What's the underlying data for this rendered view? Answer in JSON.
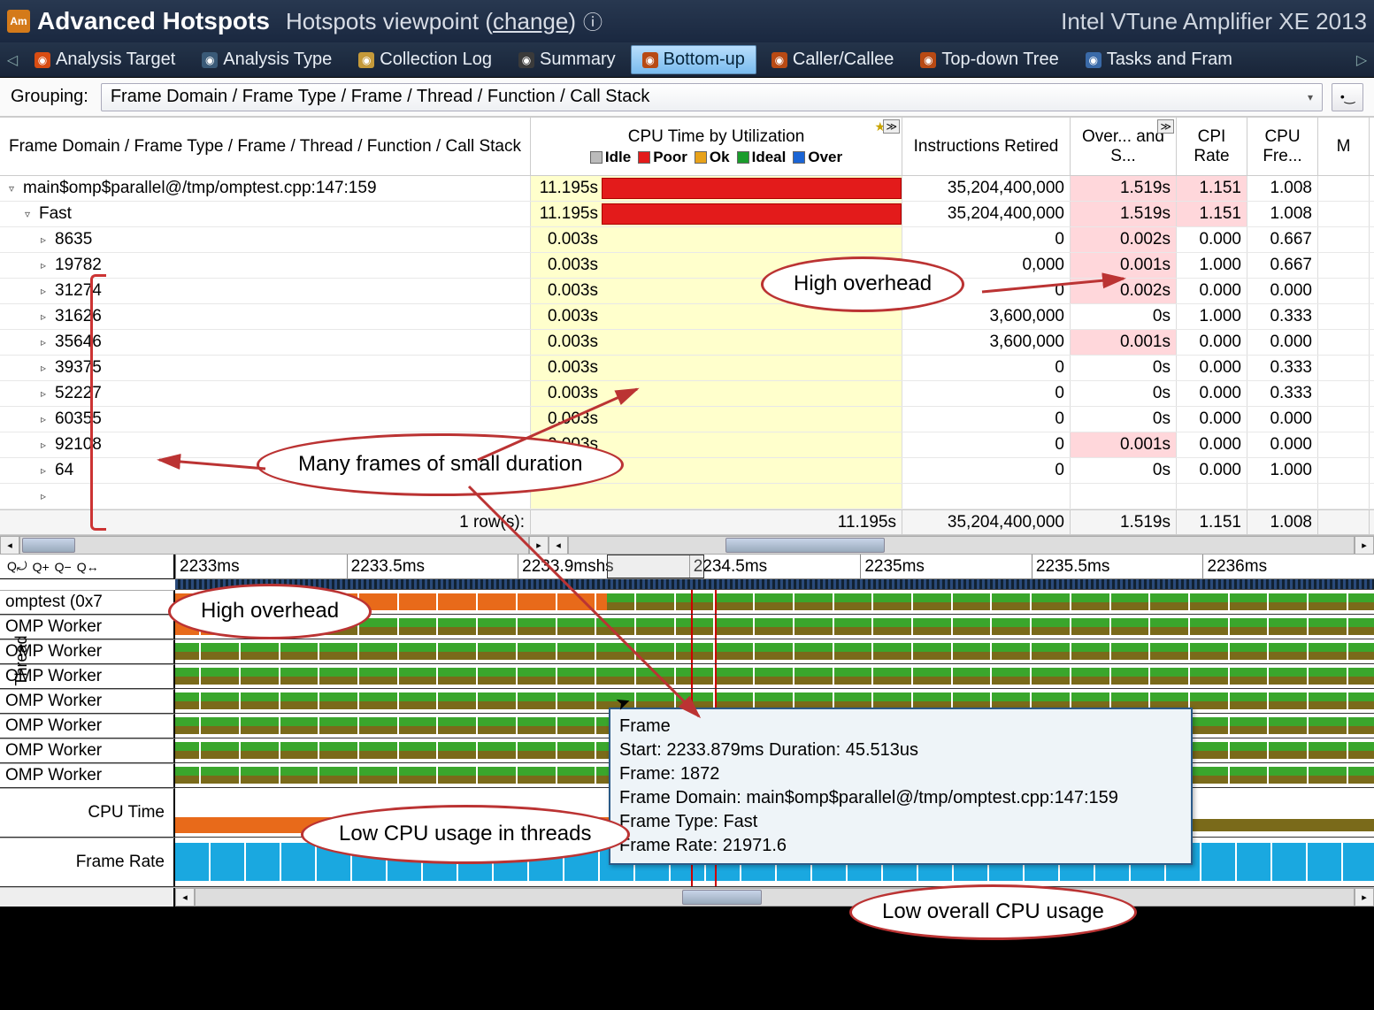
{
  "header": {
    "title": "Advanced Hotspots",
    "viewpoint_prefix": "Hotspots viewpoint (",
    "viewpoint_link": "change",
    "viewpoint_suffix": ")",
    "help": "ⓘ",
    "product": "Intel VTune Amplifier XE 2013"
  },
  "tabs": [
    {
      "label": "Analysis Target",
      "icon": "ic-target"
    },
    {
      "label": "Analysis Type",
      "icon": "ic-type"
    },
    {
      "label": "Collection Log",
      "icon": "ic-log"
    },
    {
      "label": "Summary",
      "icon": "ic-summary"
    },
    {
      "label": "Bottom-up",
      "icon": "ic-bottom",
      "active": true
    },
    {
      "label": "Caller/Callee",
      "icon": "ic-caller"
    },
    {
      "label": "Top-down Tree",
      "icon": "ic-topdown"
    },
    {
      "label": "Tasks and Fram",
      "icon": "ic-tasks"
    }
  ],
  "grouping": {
    "label": "Grouping:",
    "value": "Frame Domain / Frame Type / Frame / Thread / Function / Call Stack"
  },
  "columns": {
    "c0": "Frame Domain / Frame Type / Frame / Thread / Function / Call Stack",
    "c1": "CPU Time by Utilization",
    "c2": "Instructions Retired",
    "c3": "Over... and S...",
    "c4": "CPI Rate",
    "c5": "CPU Fre...",
    "c6": "M",
    "legend_idle": "Idle",
    "legend_poor": "Poor",
    "legend_ok": "Ok",
    "legend_ideal": "Ideal",
    "legend_over": "Over"
  },
  "rows": [
    {
      "indent": 1,
      "toggle": "▿",
      "name": "main$omp$parallel@/tmp/omptest.cpp:147:159",
      "time": "11.195s",
      "bar": 100,
      "instr": "35,204,400,000",
      "over": "1.519s",
      "over_pink": true,
      "cpi": "1.151",
      "cpi_pink": true,
      "fre": "1.008"
    },
    {
      "indent": 2,
      "toggle": "▿",
      "name": "Fast",
      "time": "11.195s",
      "bar": 100,
      "instr": "35,204,400,000",
      "over": "1.519s",
      "over_pink": true,
      "cpi": "1.151",
      "cpi_pink": true,
      "fre": "1.008"
    },
    {
      "indent": 3,
      "toggle": "▹",
      "name": "8635",
      "time": "0.003s",
      "bar": 0,
      "instr": "0",
      "over": "0.002s",
      "over_pink": true,
      "cpi": "0.000",
      "fre": "0.667"
    },
    {
      "indent": 3,
      "toggle": "▹",
      "name": "19782",
      "time": "0.003s",
      "bar": 0,
      "instr": "0,000",
      "over": "0.001s",
      "over_pink": true,
      "cpi": "1.000",
      "fre": "0.667"
    },
    {
      "indent": 3,
      "toggle": "▹",
      "name": "31274",
      "time": "0.003s",
      "bar": 0,
      "instr": "0",
      "over": "0.002s",
      "over_pink": true,
      "cpi": "0.000",
      "fre": "0.000"
    },
    {
      "indent": 3,
      "toggle": "▹",
      "name": "31626",
      "time": "0.003s",
      "bar": 0,
      "instr": "3,600,000",
      "over": "0s",
      "cpi": "1.000",
      "fre": "0.333"
    },
    {
      "indent": 3,
      "toggle": "▹",
      "name": "35646",
      "time": "0.003s",
      "bar": 0,
      "instr": "3,600,000",
      "over": "0.001s",
      "over_pink": true,
      "cpi": "0.000",
      "fre": "0.000"
    },
    {
      "indent": 3,
      "toggle": "▹",
      "name": "39375",
      "time": "0.003s",
      "bar": 0,
      "instr": "0",
      "over": "0s",
      "cpi": "0.000",
      "fre": "0.333"
    },
    {
      "indent": 3,
      "toggle": "▹",
      "name": "52227",
      "time": "0.003s",
      "bar": 0,
      "instr": "0",
      "over": "0s",
      "cpi": "0.000",
      "fre": "0.333"
    },
    {
      "indent": 3,
      "toggle": "▹",
      "name": "60355",
      "time": "0.003s",
      "bar": 0,
      "instr": "0",
      "over": "0s",
      "cpi": "0.000",
      "fre": "0.000"
    },
    {
      "indent": 3,
      "toggle": "▹",
      "name": "92108",
      "time": "0.003s",
      "bar": 0,
      "instr": "0",
      "over": "0.001s",
      "over_pink": true,
      "cpi": "0.000",
      "fre": "0.000"
    },
    {
      "indent": 3,
      "toggle": "▹",
      "name": "64",
      "time": "0.002s",
      "bar": 0,
      "instr": "0",
      "over": "0s",
      "cpi": "0.000",
      "fre": "1.000"
    },
    {
      "indent": 3,
      "toggle": "▹",
      "name": "",
      "time": "",
      "bar": -1,
      "instr": "",
      "over": "",
      "cpi": "",
      "fre": ""
    }
  ],
  "summary": {
    "label_suffix": "1 row(s):",
    "time": "11.195s",
    "instr": "35,204,400,000",
    "over": "1.519s",
    "cpi": "1.151",
    "fre": "1.008"
  },
  "ruler_ticks": [
    "2233ms",
    "2233.5ms",
    "2233.9ms",
    "2234.5ms",
    "2235ms",
    "2235.5ms",
    "2236ms"
  ],
  "ruler_extra": "hs",
  "threads": [
    "omptest (0x7",
    "OMP Worker",
    "OMP Worker",
    "OMP Worker",
    "OMP Worker",
    "OMP Worker",
    "OMP Worker",
    "OMP Worker"
  ],
  "thread_axis": "Thread",
  "cpu_label": "CPU Time",
  "fr_label": "Frame Rate",
  "tooltip": {
    "title": "Frame",
    "l1": "Start: 2233.879ms Duration: 45.513us",
    "l2": "Frame: 1872",
    "l3": "Frame Domain: main$omp$parallel@/tmp/omptest.cpp:147:159",
    "l4": "Frame Type: Fast",
    "l5": "Frame Rate: 21971.6"
  },
  "callouts": {
    "high_overhead": "High overhead",
    "many_frames": "Many frames of small duration",
    "high_overhead2": "High overhead",
    "low_cpu_threads": "Low CPU usage in threads",
    "low_overall": "Low overall CPU usage"
  }
}
